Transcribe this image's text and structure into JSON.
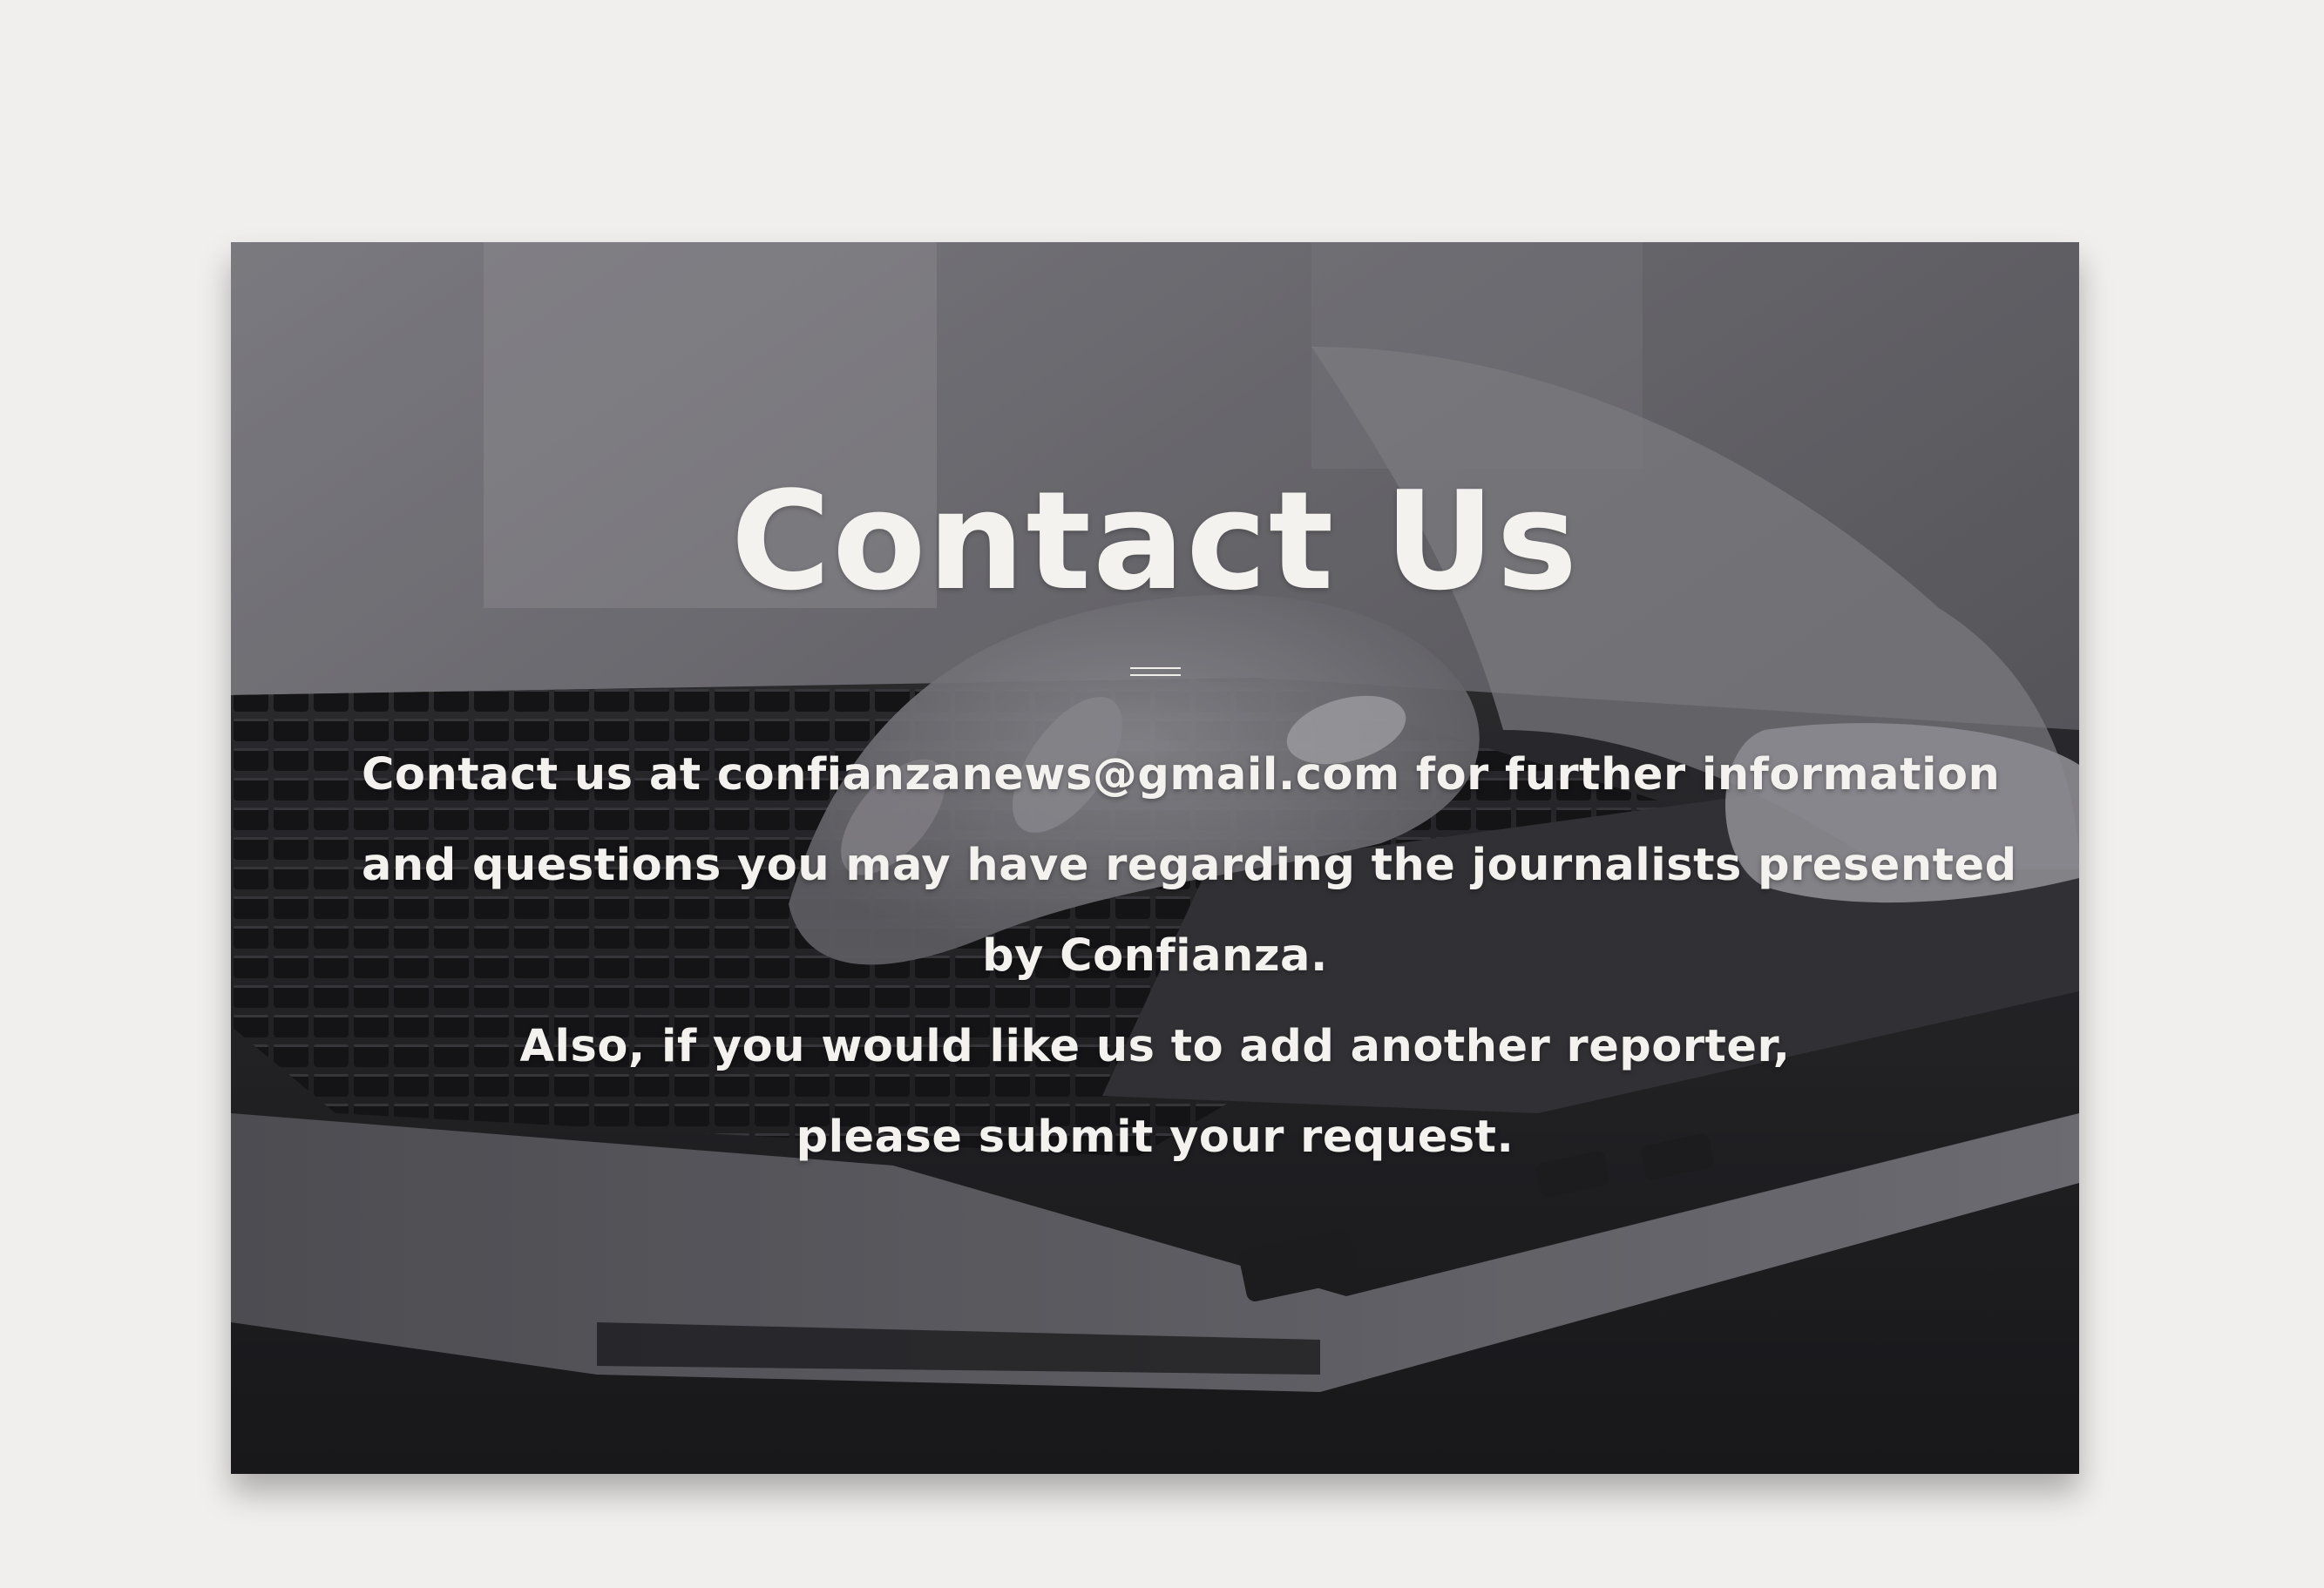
{
  "hero": {
    "title": "Contact Us",
    "lines": [
      "Contact us at confianzanews@gmail.com for further information",
      "and questions you may have regarding the journalists presented",
      "by Confianza.",
      "Also, if you would like us to add another reporter,",
      "please submit your request."
    ],
    "background_image": "laptop-typing-hands-grayscale"
  },
  "colors": {
    "page_background": "#f0efed",
    "text": "#f3f2ef"
  }
}
